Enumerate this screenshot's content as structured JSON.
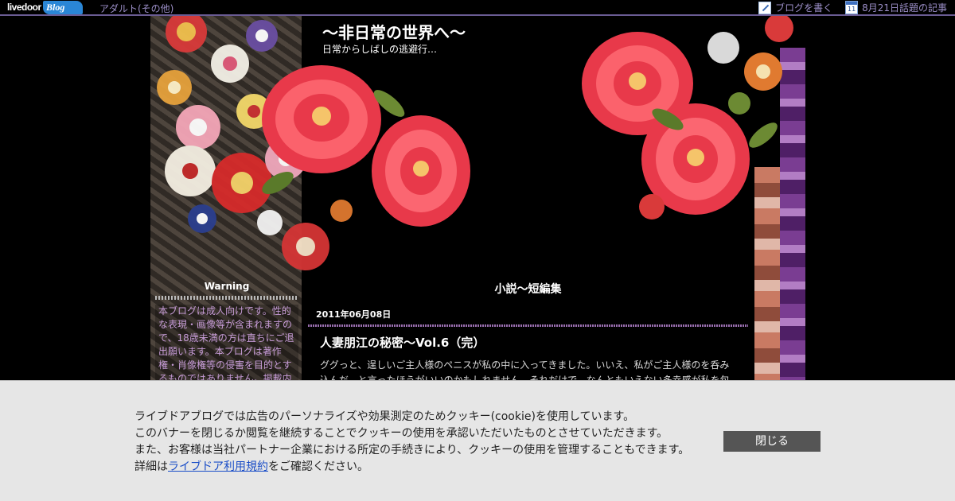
{
  "topbar": {
    "logo_text": "livedoor",
    "logo_blog": "Blog",
    "category_link": "アダルト(その他)",
    "write_blog": "ブログを書く",
    "calendar_day": "11",
    "topic_link": "8月21日話題の記事"
  },
  "header": {
    "title": "～非日常の世界へ～",
    "description": "日常からしばしの逃避行…"
  },
  "sidebar": {
    "widget_title": "Warning",
    "widget_body": "本ブログは成人向けです。性的な表現・画像等が含まれますので、18歳未満の方は直ちにご退出願います。本ブログは著作権・肖像権等の侵害を目的とするものではありません。掲載内"
  },
  "main": {
    "category_heading": "小説～短編集",
    "post_date": "2011年06月08日",
    "post_title": "人妻朋江の秘密～Vol.6（完）",
    "post_body": "ググっと、逞しいご主人様のペニスが私の中に入ってきました。いいえ、私がご主人様のを呑み込んだ、と言ったほうがいいのかもしれません。それだけで、なんともいえない多幸感が私を包"
  },
  "cookie": {
    "line1": "ライブドアブログでは広告のパーソナライズや効果測定のためクッキー(cookie)を使用しています。",
    "line2": "このバナーを閉じるか閲覧を継続することでクッキーの使用を承認いただいたものとさせていただきます。",
    "line3": "また、お客様は当社パートナー企業における所定の手続きにより、クッキーの使用を管理することもできます。",
    "line4_prefix": "詳細は",
    "line4_link": "ライブドア利用規約",
    "line4_suffix": "をご確認ください。",
    "close_label": "閉じる"
  },
  "colors": {
    "link_purple": "#9b8ec7",
    "accent_purple": "#6a5c93",
    "peony_red": "#e8394a",
    "banner_bg": "#e6e6e6",
    "close_button": "#555555"
  }
}
